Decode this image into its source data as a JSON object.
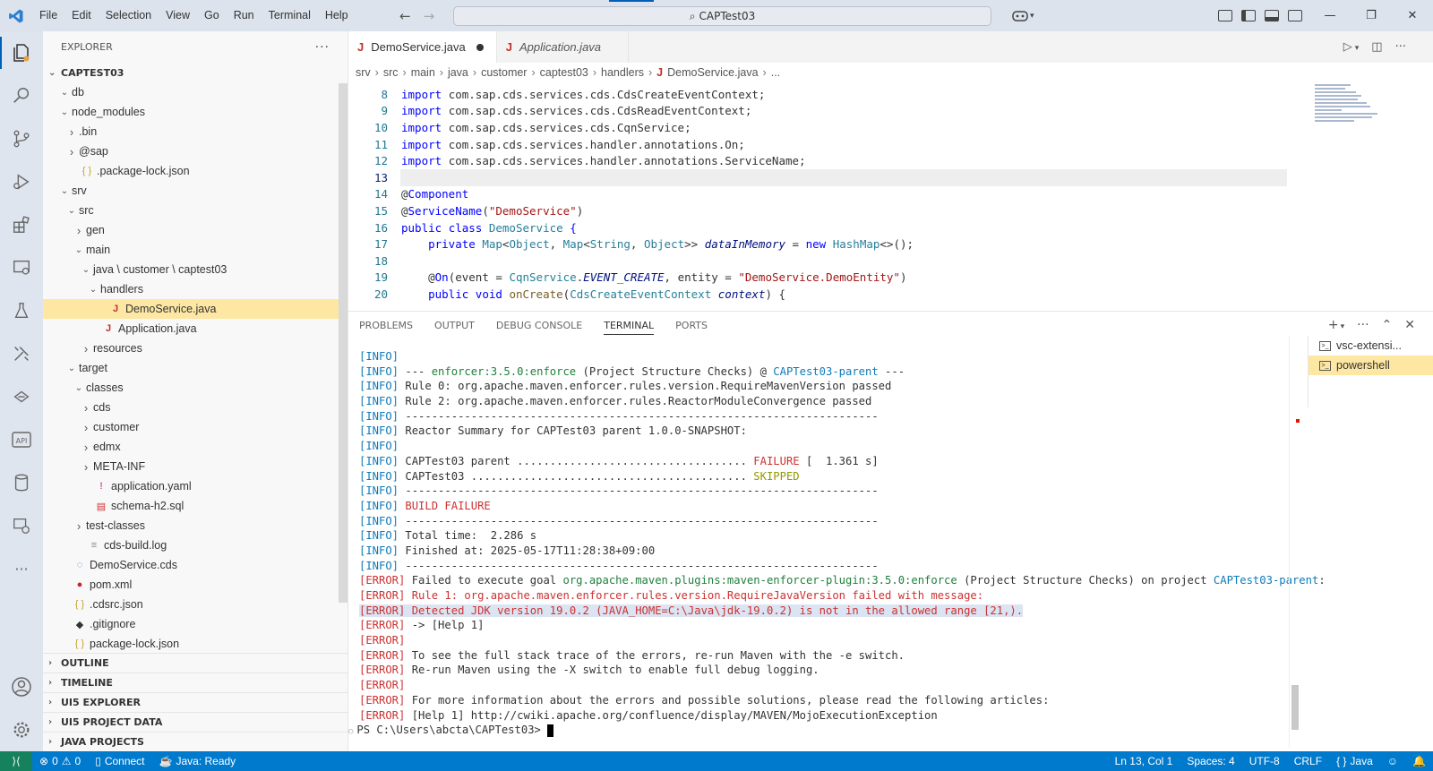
{
  "menu": [
    "File",
    "Edit",
    "Selection",
    "View",
    "Go",
    "Run",
    "Terminal",
    "Help"
  ],
  "command_center": "CAPTest03",
  "explorer": {
    "title": "EXPLORER",
    "root": "CAPTEST03",
    "tree": [
      {
        "label": "db",
        "depth": 1,
        "chevron": "down",
        "icon": ""
      },
      {
        "label": "node_modules",
        "depth": 1,
        "chevron": "down",
        "icon": ""
      },
      {
        "label": ".bin",
        "depth": 2,
        "chevron": "right",
        "icon": ""
      },
      {
        "label": "@sap",
        "depth": 2,
        "chevron": "right",
        "icon": ""
      },
      {
        "label": ".package-lock.json",
        "depth": 2,
        "chevron": "",
        "icon": "{}"
      },
      {
        "label": "srv",
        "depth": 1,
        "chevron": "down",
        "icon": ""
      },
      {
        "label": "src",
        "depth": 2,
        "chevron": "down",
        "icon": ""
      },
      {
        "label": "gen",
        "depth": 3,
        "chevron": "right",
        "icon": ""
      },
      {
        "label": "main",
        "depth": 3,
        "chevron": "down",
        "icon": ""
      },
      {
        "label": "java \\ customer \\ captest03",
        "depth": 4,
        "chevron": "down",
        "icon": ""
      },
      {
        "label": "handlers",
        "depth": 5,
        "chevron": "down",
        "icon": ""
      },
      {
        "label": "DemoService.java",
        "depth": 6,
        "chevron": "",
        "icon": "J",
        "selected": true
      },
      {
        "label": "Application.java",
        "depth": 5,
        "chevron": "",
        "icon": "J"
      },
      {
        "label": "resources",
        "depth": 4,
        "chevron": "right",
        "icon": ""
      },
      {
        "label": "target",
        "depth": 2,
        "chevron": "down",
        "icon": ""
      },
      {
        "label": "classes",
        "depth": 3,
        "chevron": "down",
        "icon": ""
      },
      {
        "label": "cds",
        "depth": 4,
        "chevron": "right",
        "icon": ""
      },
      {
        "label": "customer",
        "depth": 4,
        "chevron": "right",
        "icon": ""
      },
      {
        "label": "edmx",
        "depth": 4,
        "chevron": "right",
        "icon": ""
      },
      {
        "label": "META-INF",
        "depth": 4,
        "chevron": "right",
        "icon": ""
      },
      {
        "label": "application.yaml",
        "depth": 4,
        "chevron": "",
        "icon": "!"
      },
      {
        "label": "schema-h2.sql",
        "depth": 4,
        "chevron": "",
        "icon": "db"
      },
      {
        "label": "test-classes",
        "depth": 3,
        "chevron": "right",
        "icon": ""
      },
      {
        "label": "cds-build.log",
        "depth": 3,
        "chevron": "",
        "icon": "≡"
      },
      {
        "label": "DemoService.cds",
        "depth": 1,
        "chevron": "",
        "icon": "cds"
      },
      {
        "label": "pom.xml",
        "depth": 1,
        "chevron": "",
        "icon": "pin"
      },
      {
        "label": ".cdsrc.json",
        "depth": 1,
        "chevron": "",
        "icon": "{}"
      },
      {
        "label": ".gitignore",
        "depth": 1,
        "chevron": "",
        "icon": "git"
      },
      {
        "label": "package-lock.json",
        "depth": 1,
        "chevron": "",
        "icon": "{}"
      }
    ],
    "sections": [
      "OUTLINE",
      "TIMELINE",
      "UI5 EXPLORER",
      "UI5 PROJECT DATA",
      "JAVA PROJECTS"
    ]
  },
  "tabs": [
    {
      "label": "DemoService.java",
      "active": true,
      "dirty": true
    },
    {
      "label": "Application.java",
      "active": false,
      "dirty": false
    }
  ],
  "breadcrumb": [
    "srv",
    "src",
    "main",
    "java",
    "customer",
    "captest03",
    "handlers",
    "DemoService.java",
    "..."
  ],
  "code_lines": [
    8,
    9,
    10,
    11,
    12,
    13,
    14,
    15,
    16,
    17,
    18,
    19,
    20
  ],
  "code": {
    "l8": [
      "import",
      "com.sap.cds.services.cds.CdsCreateEventContext;"
    ],
    "l9": [
      "import",
      "com.sap.cds.services.cds.CdsReadEventContext;"
    ],
    "l10": [
      "import",
      "com.sap.cds.services.cds.CqnService;"
    ],
    "l11": [
      "import",
      "com.sap.cds.services.handler.annotations.On;"
    ],
    "l12": [
      "import",
      "com.sap.cds.services.handler.annotations.ServiceName;"
    ],
    "l14": [
      "@",
      "Component"
    ],
    "l15": [
      "@",
      "ServiceName",
      "(",
      "\"DemoService\"",
      ")"
    ],
    "l16": [
      "public",
      "class",
      "DemoService",
      "{"
    ],
    "l17": [
      "private",
      "Map",
      "<",
      "Object",
      ", ",
      "Map",
      "<",
      "String",
      ", ",
      "Object",
      ">> ",
      "dataInMemory",
      " = ",
      "new",
      "HashMap",
      "<>();"
    ],
    "l19": [
      "@",
      "On",
      "(event = ",
      "CqnService",
      ".",
      "EVENT_CREATE",
      ", entity = ",
      "\"DemoService.DemoEntity\"",
      ")"
    ],
    "l20": [
      "public",
      "void",
      "onCreate",
      "(",
      "CdsCreateEventContext",
      "context",
      ") {"
    ]
  },
  "panel_tabs": [
    "PROBLEMS",
    "OUTPUT",
    "DEBUG CONSOLE",
    "TERMINAL",
    "PORTS"
  ],
  "terminal": {
    "lines": [
      "[INFO]",
      "[INFO] --- enforcer:3.5.0:enforce (Project Structure Checks) @ CAPTest03-parent ---",
      "[INFO] Rule 0: org.apache.maven.enforcer.rules.version.RequireMavenVersion passed",
      "[INFO] Rule 2: org.apache.maven.enforcer.rules.ReactorModuleConvergence passed",
      "[INFO] ------------------------------------------------------------------------",
      "[INFO] Reactor Summary for CAPTest03 parent 1.0.0-SNAPSHOT:",
      "[INFO]",
      "[INFO] CAPTest03 parent ................................... FAILURE [  1.361 s]",
      "[INFO] CAPTest03 .......................................... SKIPPED",
      "[INFO] ------------------------------------------------------------------------",
      "[INFO] BUILD FAILURE",
      "[INFO] ------------------------------------------------------------------------",
      "[INFO] Total time:  2.286 s",
      "[INFO] Finished at: 2025-05-17T11:28:38+09:00",
      "[INFO] ------------------------------------------------------------------------",
      "[ERROR] Failed to execute goal org.apache.maven.plugins:maven-enforcer-plugin:3.5.0:enforce (Project Structure Checks) on project CAPTest03-parent:",
      "[ERROR] Rule 1: org.apache.maven.enforcer.rules.version.RequireJavaVersion failed with message:",
      "[ERROR] Detected JDK version 19.0.2 (JAVA_HOME=C:\\Java\\jdk-19.0.2) is not in the allowed range [21,).",
      "[ERROR] -> [Help 1]",
      "[ERROR]",
      "[ERROR] To see the full stack trace of the errors, re-run Maven with the -e switch.",
      "[ERROR] Re-run Maven using the -X switch to enable full debug logging.",
      "[ERROR]",
      "[ERROR] For more information about the errors and possible solutions, please read the following articles:",
      "[ERROR] [Help 1] http://cwiki.apache.org/confluence/display/MAVEN/MojoExecutionException",
      "PS C:\\Users\\abcta\\CAPTest03> "
    ],
    "sessions": [
      {
        "label": "vsc-extensi...",
        "active": false
      },
      {
        "label": "powershell",
        "active": true
      }
    ]
  },
  "status": {
    "errors": "0",
    "warnings": "0",
    "connect": "Connect",
    "java": "Java: Ready",
    "position": "Ln 13, Col 1",
    "spaces": "Spaces: 4",
    "encoding": "UTF-8",
    "eol": "CRLF",
    "language": "Java"
  },
  "colors": {
    "accent": "#005fb8",
    "statusbar": "#007acc",
    "selection": "#fde7a3",
    "error": "#cd3131"
  }
}
